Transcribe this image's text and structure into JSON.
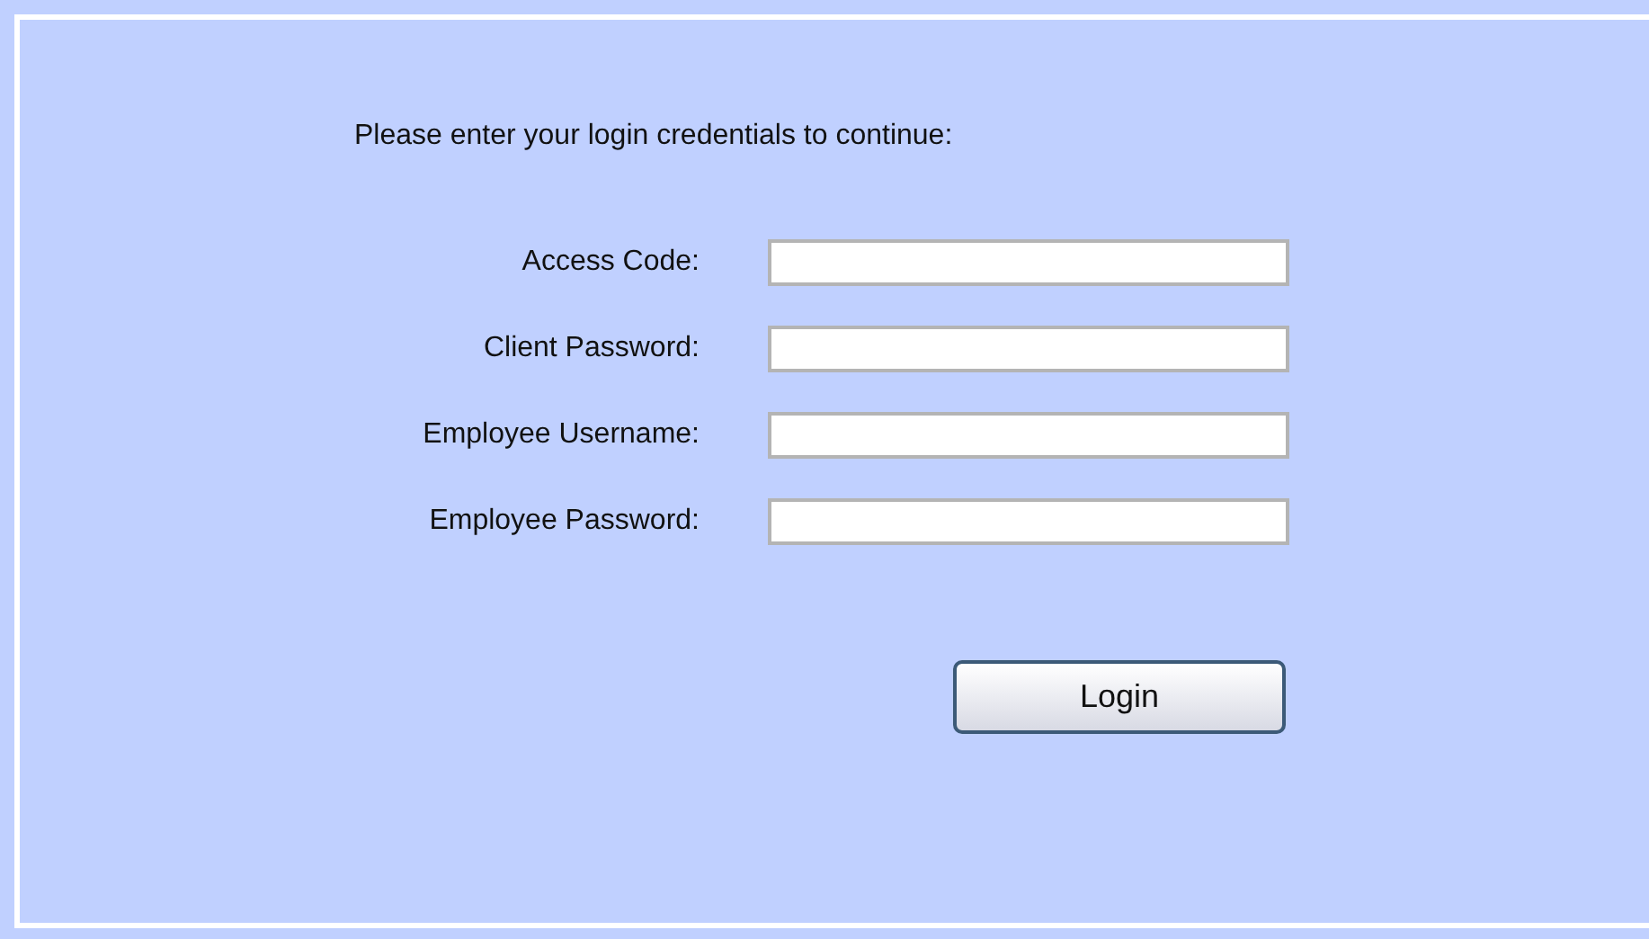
{
  "prompt": "Please enter your login credentials to continue:",
  "fields": [
    {
      "label": "Access Code:"
    },
    {
      "label": "Client Password:"
    },
    {
      "label": "Employee Username:"
    },
    {
      "label": "Employee Password:"
    }
  ],
  "button": "Login"
}
